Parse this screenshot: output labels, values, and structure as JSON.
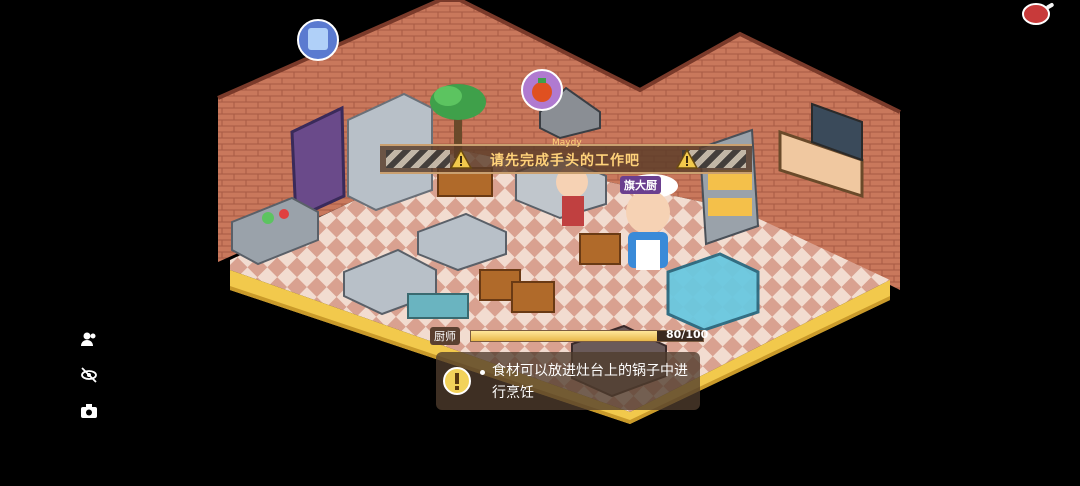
{
  "hud": {
    "banner_text": "请先完成手头的工作吧",
    "chef_name": "旗大厨",
    "character_name_top": "Maydy",
    "progress_label": "厨师",
    "progress_text": "80/100",
    "progress_fraction": 0.8,
    "tip_text": "食材可以放进灶台上的锅子中进行烹饪"
  },
  "icons": {
    "side": [
      "friends-icon",
      "hide-icon",
      "photo-icon"
    ],
    "corner": "meat-icon",
    "markers": [
      "uniform-marker-icon",
      "tomato-marker-icon"
    ]
  },
  "colors": {
    "background": "#000000",
    "wall": "#c87a5a",
    "floor_light": "#f0d8c8",
    "floor_dark": "#d09080",
    "platform_edge": "#f2c94c",
    "banner_text": "#ffd27a"
  }
}
